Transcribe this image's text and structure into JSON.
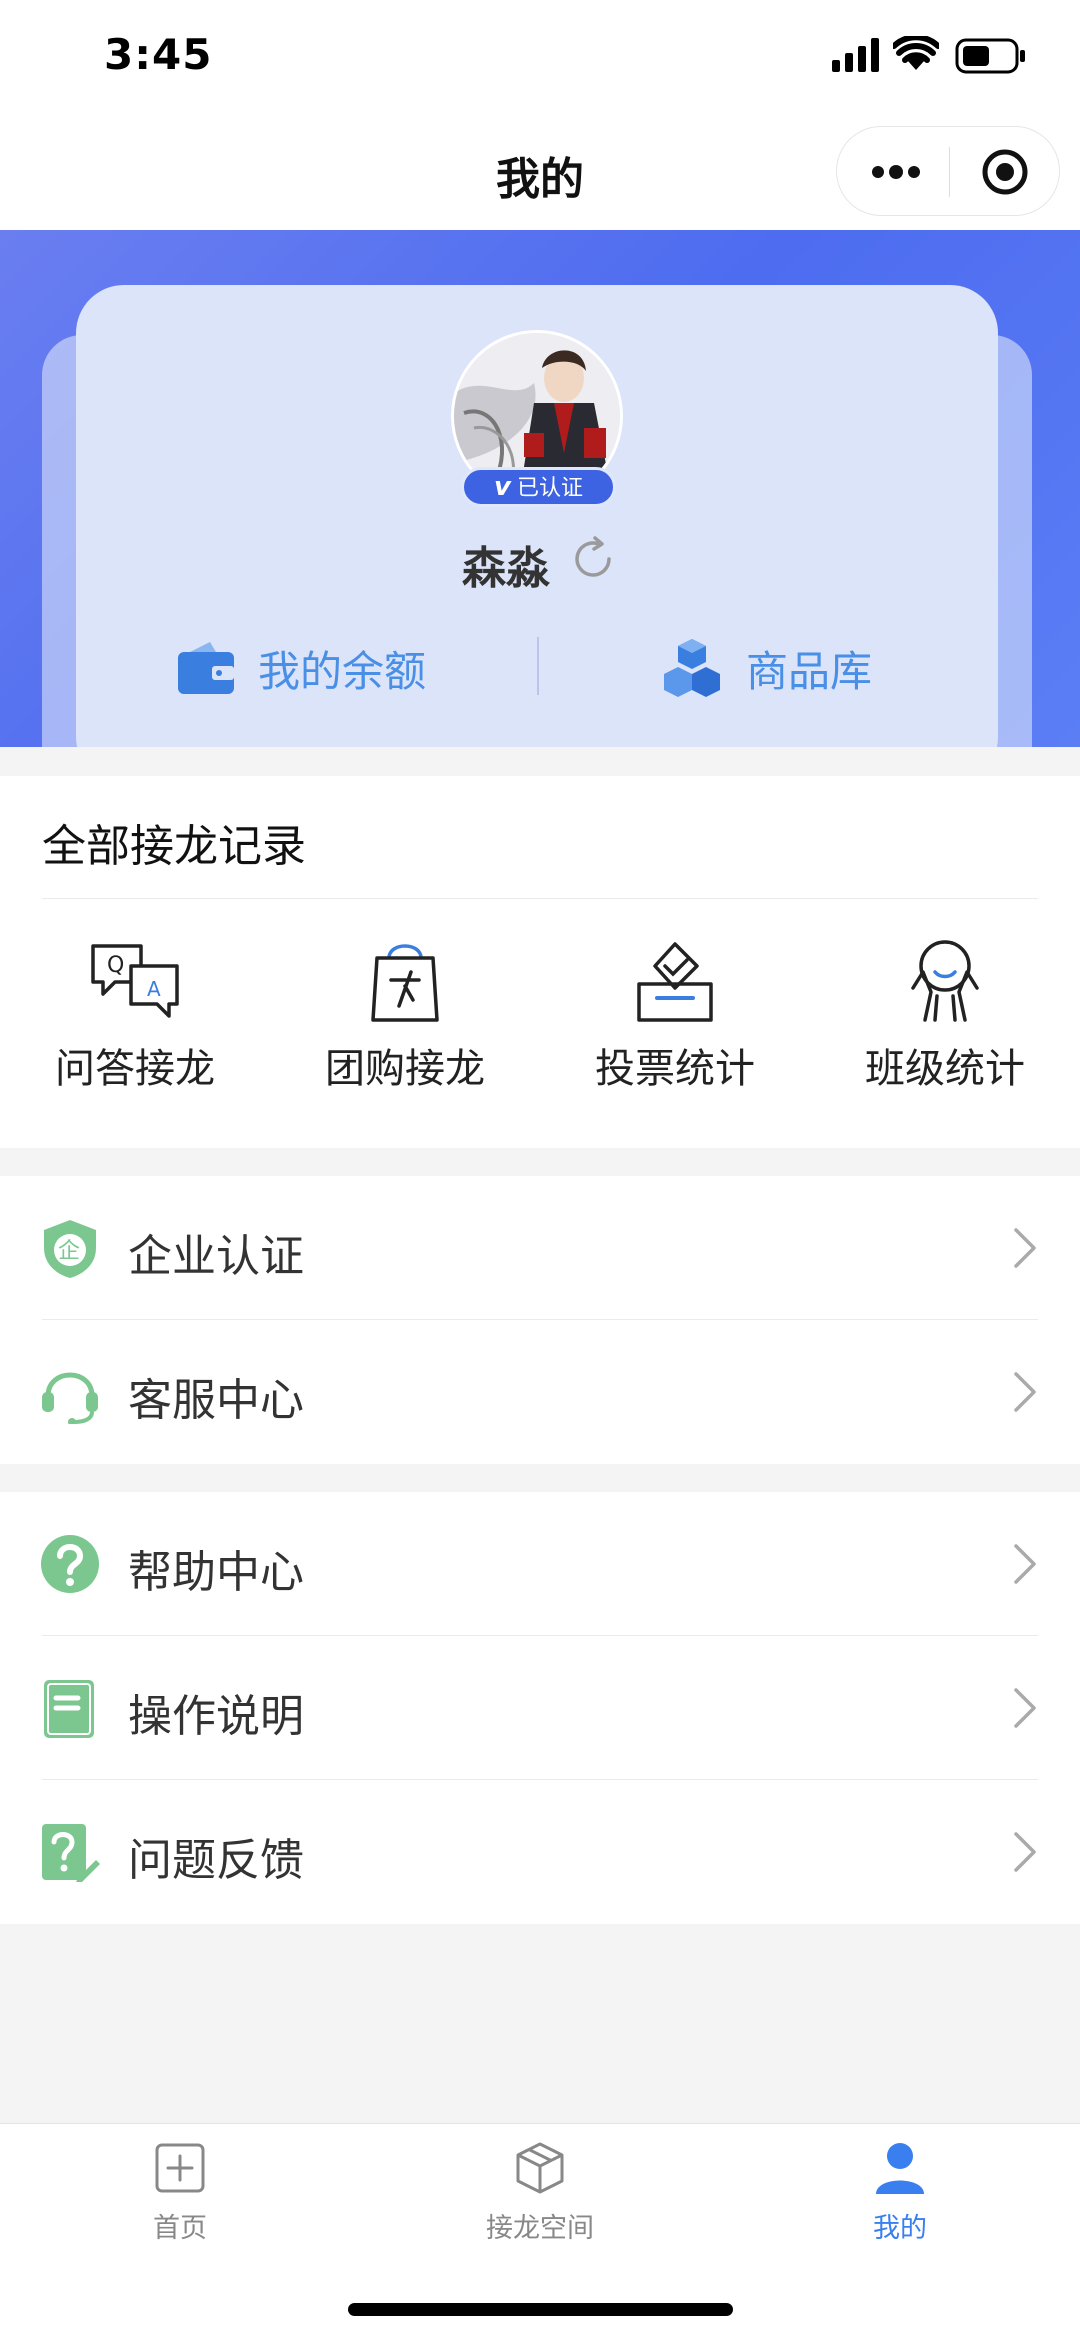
{
  "status_bar": {
    "time": "3:45",
    "icons": [
      "signal-icon",
      "wifi-icon",
      "battery-icon"
    ]
  },
  "navbar": {
    "title": "我的",
    "capsule_icons": [
      "more-icon",
      "target-icon"
    ]
  },
  "profile": {
    "badge": "已认证",
    "badge_mark": "v",
    "nickname": "森淼",
    "refresh_icon": "refresh-icon",
    "actions": [
      {
        "label": "我的余额",
        "icon": "wallet-icon"
      },
      {
        "label": "商品库",
        "icon": "boxes-icon"
      }
    ]
  },
  "records": {
    "title": "全部接龙记录",
    "items": [
      {
        "label": "问答接龙",
        "icon": "qa-icon"
      },
      {
        "label": "团购接龙",
        "icon": "shopping-bag-icon"
      },
      {
        "label": "投票统计",
        "icon": "ballot-box-icon"
      },
      {
        "label": "班级统计",
        "icon": "class-group-icon"
      }
    ]
  },
  "menu_groups": [
    [
      {
        "label": "企业认证",
        "icon": "enterprise-shield-icon"
      },
      {
        "label": "客服中心",
        "icon": "headset-icon"
      }
    ],
    [
      {
        "label": "帮助中心",
        "icon": "help-icon"
      },
      {
        "label": "操作说明",
        "icon": "manual-icon"
      },
      {
        "label": "问题反馈",
        "icon": "feedback-icon"
      }
    ]
  ],
  "tabbar": {
    "items": [
      {
        "label": "首页",
        "icon": "plus-square-icon",
        "active": false
      },
      {
        "label": "接龙空间",
        "icon": "cube-icon",
        "active": false
      },
      {
        "label": "我的",
        "icon": "person-icon",
        "active": true
      }
    ]
  },
  "colors": {
    "brand_blue": "#4d6cf0",
    "active_tab": "#3a7ff0",
    "menu_icon_green": "#7cc78f",
    "link_blue": "#4a8fe6"
  }
}
